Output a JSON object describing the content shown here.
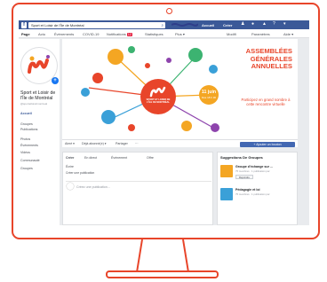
{
  "browser": {
    "search_value": "Sport et Loisir de l'Île de Montréal",
    "topbar_links": [
      "Accueil",
      "Créer"
    ]
  },
  "page_nav": {
    "items": [
      "Page",
      "Actu",
      "Événements",
      "COVID-19",
      "Notifications",
      "Statistiques",
      "Plus ▾",
      "Modifi",
      "Paramètres",
      "Aide ▾"
    ],
    "notifications_badge": "12"
  },
  "sidebar": {
    "page_name": "Sport et Loisir de l'Île de Montréal",
    "page_handle": "@sportetloisirmontreal",
    "items": [
      "Accueil",
      "Groupes",
      "Publications",
      "Photos",
      "Événements",
      "Vidéos",
      "Communauté",
      "Groupes"
    ]
  },
  "cover": {
    "headline": "ASSEMBLÉES GÉNÉRALES ANNUELLES",
    "subline": "Participez en grand nombre à cette rencontre virtuelle",
    "date_main": "11 juin",
    "date_sub": "Dès 18 h 30",
    "badge_text": "SPORT ET LOISIR DE L'ÎLE DE MONTRÉAL"
  },
  "action_bar": {
    "buttons": [
      "Aimé ▾",
      "Déjà abonné(e) ▾",
      "Partager",
      "···"
    ],
    "cta": "+ Ajouter un bouton"
  },
  "composer": {
    "tabs": [
      "Créer",
      "En direct",
      "Événement",
      "Offre"
    ],
    "line1": "Écrire",
    "line2": "Créer une publication",
    "placeholder": "Créez une publication..."
  },
  "suggestions": {
    "title": "Suggestions De Groupes",
    "groups": [
      {
        "name": "Groupe d'échange sur ...",
        "meta": "75 membres · 1 publication par",
        "join": "Rejoindre"
      },
      {
        "name": "Pédagogie et loi",
        "meta": "75 membres · 1 publication par",
        "join": ""
      }
    ]
  },
  "colors": {
    "fb_blue": "#3b5998",
    "accent": "#e8452a",
    "badge_orange": "#f4a623"
  }
}
